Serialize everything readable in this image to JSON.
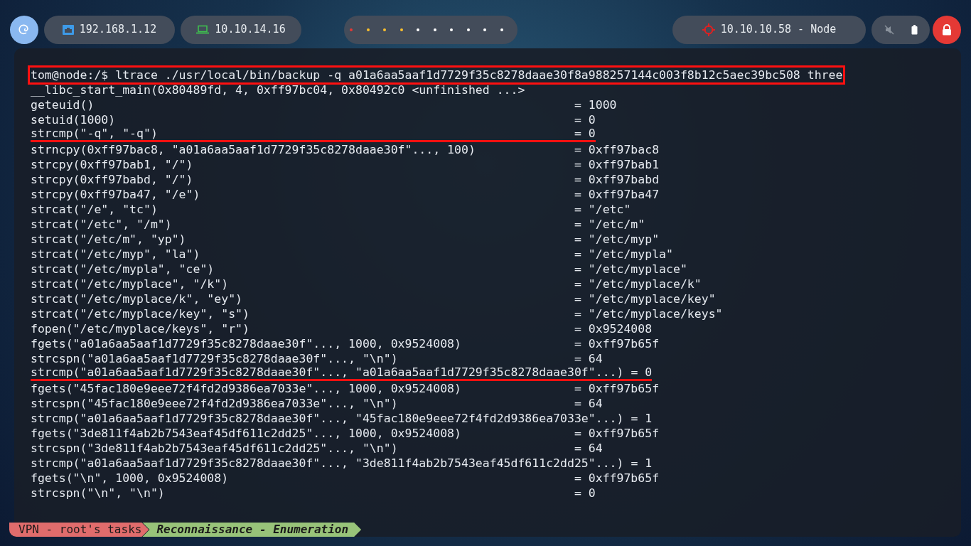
{
  "top_bar": {
    "left": [
      {
        "kind": "ethernet",
        "text": "192.168.1.12"
      },
      {
        "kind": "laptop",
        "text": "10.10.14.16"
      }
    ],
    "workspaces": [
      {
        "color": "#e53935"
      },
      {
        "color": "#fbc02d"
      },
      {
        "color": "#fbc02d"
      },
      {
        "color": "#fbc02d"
      },
      {
        "color": "#ffffff"
      },
      {
        "color": "#ffffff"
      },
      {
        "color": "#ffffff"
      },
      {
        "color": "#ffffff"
      },
      {
        "color": "#ffffff"
      },
      {
        "color": "#ffffff"
      }
    ],
    "target": "10.10.10.58 - Node"
  },
  "terminal": {
    "prompt": "tom@node:/$",
    "command": "ltrace ./usr/local/bin/backup -q a01a6aa5aaf1d7729f35c8278daae30f8a988257144c003f8b12c5aec39bc508 three",
    "lines": [
      {
        "call": "__libc_start_main(0x80489fd, 4, 0xff97bc04, 0x80492c0 <unfinished ...>",
        "underlined": false
      },
      {
        "call": "geteuid()",
        "result": "= 1000",
        "underlined": false
      },
      {
        "call": "setuid(1000)",
        "result": "= 0",
        "underlined": false
      },
      {
        "call": "strcmp(\"-q\", \"-q\")",
        "result": "= 0",
        "underlined": true
      },
      {
        "call": "strncpy(0xff97bac8, \"a01a6aa5aaf1d7729f35c8278daae30f\"..., 100)",
        "result": "= 0xff97bac8",
        "underlined": false
      },
      {
        "call": "strcpy(0xff97bab1, \"/\")",
        "result": "= 0xff97bab1",
        "underlined": false
      },
      {
        "call": "strcpy(0xff97babd, \"/\")",
        "result": "= 0xff97babd",
        "underlined": false
      },
      {
        "call": "strcpy(0xff97ba47, \"/e\")",
        "result": "= 0xff97ba47",
        "underlined": false
      },
      {
        "call": "strcat(\"/e\", \"tc\")",
        "result": "= \"/etc\"",
        "underlined": false
      },
      {
        "call": "strcat(\"/etc\", \"/m\")",
        "result": "= \"/etc/m\"",
        "underlined": false
      },
      {
        "call": "strcat(\"/etc/m\", \"yp\")",
        "result": "= \"/etc/myp\"",
        "underlined": false
      },
      {
        "call": "strcat(\"/etc/myp\", \"la\")",
        "result": "= \"/etc/mypla\"",
        "underlined": false
      },
      {
        "call": "strcat(\"/etc/mypla\", \"ce\")",
        "result": "= \"/etc/myplace\"",
        "underlined": false
      },
      {
        "call": "strcat(\"/etc/myplace\", \"/k\")",
        "result": "= \"/etc/myplace/k\"",
        "underlined": false
      },
      {
        "call": "strcat(\"/etc/myplace/k\", \"ey\")",
        "result": "= \"/etc/myplace/key\"",
        "underlined": false
      },
      {
        "call": "strcat(\"/etc/myplace/key\", \"s\")",
        "result": "= \"/etc/myplace/keys\"",
        "underlined": false
      },
      {
        "call": "fopen(\"/etc/myplace/keys\", \"r\")",
        "result": "= 0x9524008",
        "underlined": false
      },
      {
        "call": "fgets(\"a01a6aa5aaf1d7729f35c8278daae30f\"..., 1000, 0x9524008)",
        "result": "= 0xff97b65f",
        "underlined": false
      },
      {
        "call": "strcspn(\"a01a6aa5aaf1d7729f35c8278daae30f\"..., \"\\n\")",
        "result": "= 64",
        "underlined": false
      },
      {
        "call": "strcmp(\"a01a6aa5aaf1d7729f35c8278daae30f\"..., \"a01a6aa5aaf1d7729f35c8278daae30f\"...)",
        "result": "= 0",
        "underlined": true
      },
      {
        "call": "fgets(\"45fac180e9eee72f4fd2d9386ea7033e\"..., 1000, 0x9524008)",
        "result": "= 0xff97b65f",
        "underlined": false
      },
      {
        "call": "strcspn(\"45fac180e9eee72f4fd2d9386ea7033e\"..., \"\\n\")",
        "result": "= 64",
        "underlined": false
      },
      {
        "call": "strcmp(\"a01a6aa5aaf1d7729f35c8278daae30f\"..., \"45fac180e9eee72f4fd2d9386ea7033e\"...)",
        "result": "= 1",
        "underlined": false
      },
      {
        "call": "fgets(\"3de811f4ab2b7543eaf45df611c2dd25\"..., 1000, 0x9524008)",
        "result": "= 0xff97b65f",
        "underlined": false
      },
      {
        "call": "strcspn(\"3de811f4ab2b7543eaf45df611c2dd25\"..., \"\\n\")",
        "result": "= 64",
        "underlined": false
      },
      {
        "call": "strcmp(\"a01a6aa5aaf1d7729f35c8278daae30f\"..., \"3de811f4ab2b7543eaf45df611c2dd25\"...)",
        "result": "= 1",
        "underlined": false
      },
      {
        "call": "fgets(\"\\n\", 1000, 0x9524008)",
        "result": "= 0xff97b65f",
        "underlined": false
      },
      {
        "call": "strcspn(\"\\n\", \"\\n\")",
        "result": "= 0",
        "underlined": false
      }
    ]
  },
  "status_line": [
    {
      "kind": "session",
      "text": "VPN - root's tasks"
    },
    {
      "kind": "window",
      "text": "Reconnaissance - Enumeration"
    }
  ]
}
